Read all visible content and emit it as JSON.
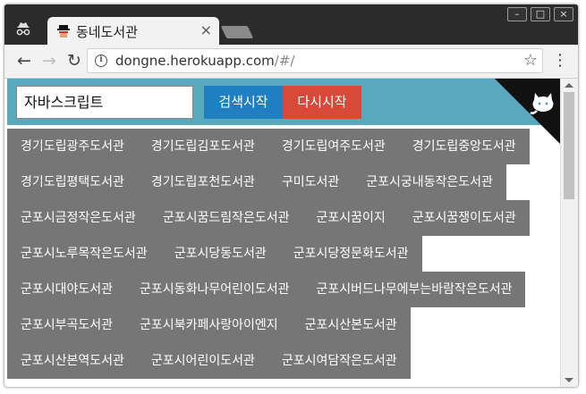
{
  "browser": {
    "tab_title": "동네도서관",
    "tab_close": "×",
    "url_main": "dongne.herokuapp.com",
    "url_rest": "/#/",
    "back_icon": "←",
    "forward_icon": "→",
    "reload_icon": "↻",
    "bookmark_icon": "☆",
    "menu_icon": "⋮",
    "info_icon": "i",
    "minimize_icon": "–",
    "maximize_icon": "□",
    "close_icon": "×"
  },
  "search": {
    "value": "자바스크립트",
    "search_label": "검색시작",
    "reset_label": "다시시작"
  },
  "libraries": [
    [
      "경기도립광주도서관",
      "경기도립김포도서관",
      "경기도립여주도서관",
      "경기도립중앙도서관"
    ],
    [
      "경기도립평택도서관",
      "경기도립포천도서관",
      "구미도서관",
      "군포시궁내동작은도서관"
    ],
    [
      "군포시금정작은도서관",
      "군포시꿈드림작은도서관",
      "군포시꿈이지",
      "군포시꿈쟁이도서관"
    ],
    [
      "군포시노루목작은도서관",
      "군포시당동도서관",
      "군포시당정문화도서관"
    ],
    [
      "군포시대야도서관",
      "군포시동화나무어린이도서관",
      "군포시버드나무에부는바람작은도서관"
    ],
    [
      "군포시부곡도서관",
      "군포시북카페사랑아이엔지",
      "군포시산본도서관"
    ],
    [
      "군포시산본역도서관",
      "군포시어린이도서관",
      "군포시여담작은도서관"
    ]
  ],
  "colors": {
    "header_bg": "#5aa8bd",
    "search_btn": "#1f7fc0",
    "reset_btn": "#d9493a",
    "item_bg": "#767676"
  }
}
